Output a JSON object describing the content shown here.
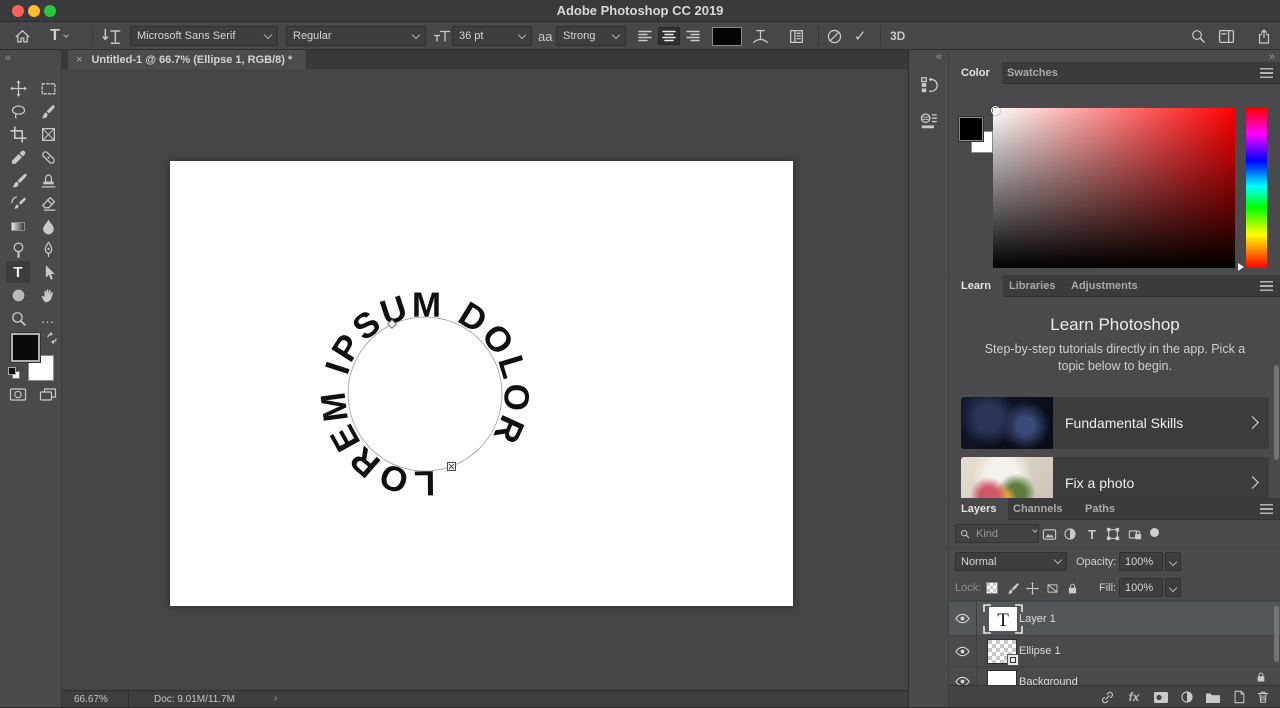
{
  "titlebar": {
    "title": "Adobe Photoshop CC 2019"
  },
  "options_bar": {
    "font_family": "Microsoft Sans Serif",
    "font_style": "Regular",
    "font_size": "36 pt",
    "anti_alias": "Strong",
    "three_d": "3D"
  },
  "document_tab": {
    "title": "Untitled-1 @ 66.7% (Ellipse 1, RGB/8) *",
    "close": "×"
  },
  "canvas": {
    "path_text": "LOREM IPSUM DOLOR"
  },
  "status_bar": {
    "zoom": "66.67%",
    "doc_sizes": "Doc: 9.01M/11.7M"
  },
  "panels": {
    "color": {
      "tab_color": "Color",
      "tab_swatches": "Swatches",
      "foreground": "#000000",
      "background": "#ffffff"
    },
    "learn": {
      "tab_learn": "Learn",
      "tab_libraries": "Libraries",
      "tab_adjustments": "Adjustments",
      "title": "Learn Photoshop",
      "subtitle": "Step-by-step tutorials directly in the app. Pick a topic below to begin.",
      "card1": "Fundamental Skills",
      "card2": "Fix a photo"
    },
    "layers": {
      "tab_layers": "Layers",
      "tab_channels": "Channels",
      "tab_paths": "Paths",
      "search_placeholder": "Kind",
      "blend_mode": "Normal",
      "opacity_label": "Opacity:",
      "opacity_value": "100%",
      "lock_label": "Lock:",
      "fill_label": "Fill:",
      "fill_value": "100%",
      "rows": [
        {
          "name": "Layer 1"
        },
        {
          "name": "Ellipse 1"
        },
        {
          "name": "Background"
        }
      ],
      "fx_label": "fx"
    }
  },
  "glyphs": {
    "type_tool": "T",
    "commit": "✓",
    "collapse_left": "«",
    "collapse_right": "»",
    "more_tools": "…",
    "status_chevron": "›",
    "anti_alias_icon": "aa"
  }
}
